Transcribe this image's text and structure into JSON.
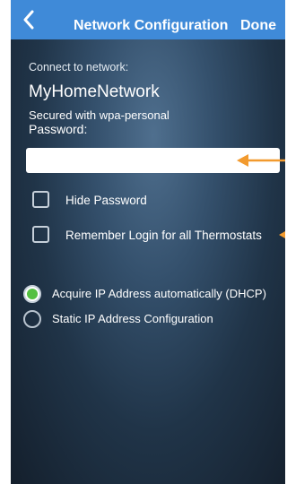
{
  "nav": {
    "title": "Network Configuration",
    "done_label": "Done"
  },
  "form": {
    "connect_label": "Connect to network:",
    "network_name": "MyHomeNetwork",
    "security_text": "Secured with wpa-personal",
    "password_label": "Password:",
    "password_value": "",
    "hide_password_label": "Hide Password",
    "remember_login_label": "Remember Login for all Thermostats",
    "radio_dhcp_label": "Acquire IP Address automatically (DHCP)",
    "radio_static_label": "Static IP Address Configuration",
    "selected_ip_option": "dhcp"
  },
  "colors": {
    "nav_bar": "#3f8ad8",
    "annotation_arrow": "#f29a2e",
    "radio_selected": "#54c041"
  },
  "icons": {
    "back": "chevron-left-icon"
  }
}
